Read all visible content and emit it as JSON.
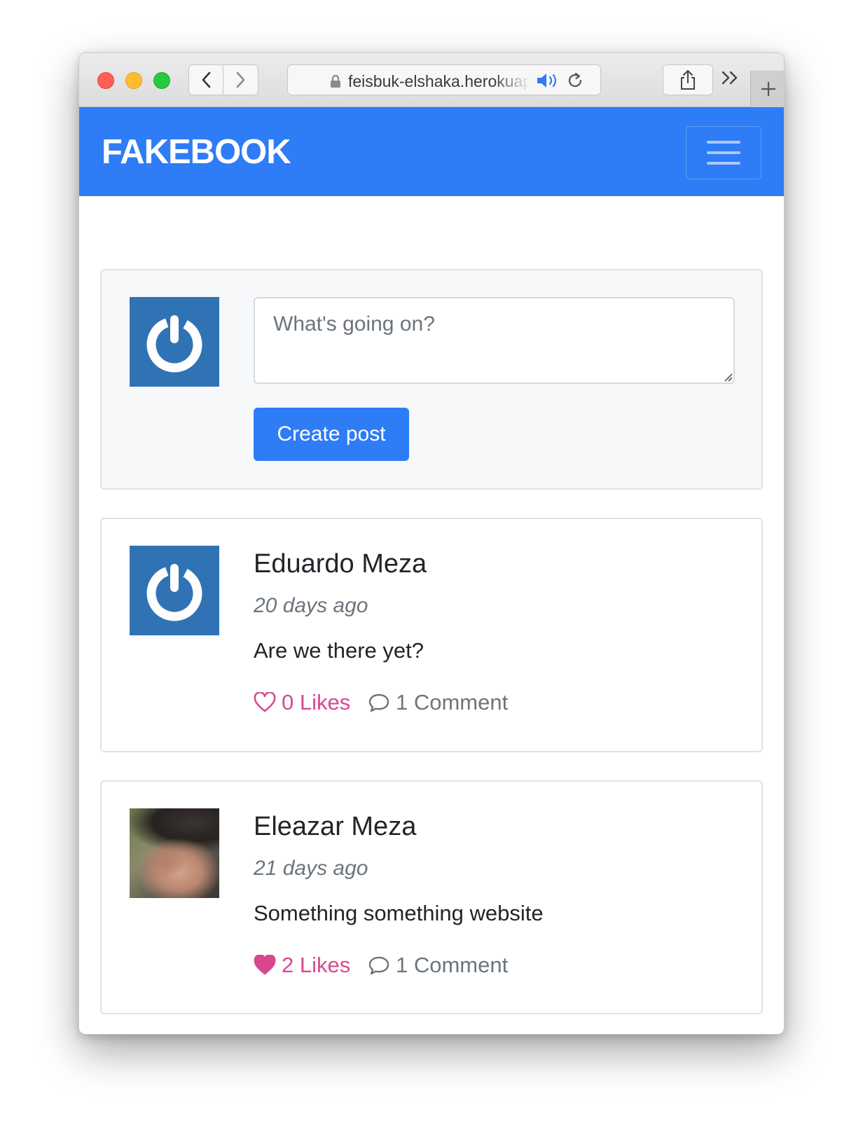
{
  "browser": {
    "url": "feisbuk-elshaka.herokuapp.com"
  },
  "navbar": {
    "brand": "FAKEBOOK",
    "bg_color": "#2e7cf6"
  },
  "composer": {
    "placeholder": "What's going on?",
    "submit_label": "Create post"
  },
  "posts": [
    {
      "author": "Eduardo Meza",
      "time": "20 days ago",
      "body": "Are we there yet?",
      "likes_label": "0 Likes",
      "liked": false,
      "comments_label": "1 Comment",
      "avatar": "default-power-avatar"
    },
    {
      "author": "Eleazar Meza",
      "time": "21 days ago",
      "body": "Something something website",
      "likes_label": "2 Likes",
      "liked": true,
      "comments_label": "1 Comment",
      "avatar": "photo-avatar"
    }
  ],
  "colors": {
    "accent": "#2e7cf6",
    "like": "#d6498e",
    "muted": "#6c757d"
  }
}
